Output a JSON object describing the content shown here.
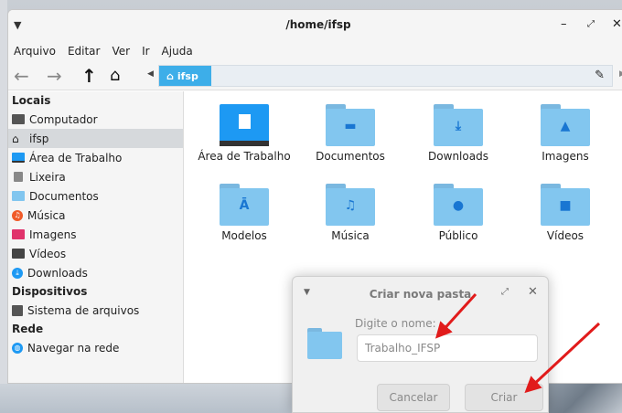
{
  "window": {
    "title": "/home/ifsp",
    "menu": [
      "Arquivo",
      "Editar",
      "Ver",
      "Ir",
      "Ajuda"
    ],
    "breadcrumb": "ifsp"
  },
  "sidebar": {
    "sections": [
      {
        "title": "Locais",
        "items": [
          {
            "label": "Computador",
            "icon": "computer-icon",
            "color": "#555555"
          },
          {
            "label": "ifsp",
            "icon": "home-icon",
            "color": "#222222",
            "active": true
          },
          {
            "label": "Área de Trabalho",
            "icon": "desktop-icon",
            "color": "#1d99f3"
          },
          {
            "label": "Lixeira",
            "icon": "trash-icon",
            "color": "#888888"
          },
          {
            "label": "Documentos",
            "icon": "documents-folder-icon",
            "color": "#82c6ef"
          },
          {
            "label": "Música",
            "icon": "music-icon",
            "color": "#f05a28"
          },
          {
            "label": "Imagens",
            "icon": "images-icon",
            "color": "#e0336b"
          },
          {
            "label": "Vídeos",
            "icon": "videos-icon",
            "color": "#444444"
          },
          {
            "label": "Downloads",
            "icon": "downloads-icon",
            "color": "#1d99f3"
          }
        ]
      },
      {
        "title": "Dispositivos",
        "items": [
          {
            "label": "Sistema de arquivos",
            "icon": "drive-icon",
            "color": "#555555"
          }
        ]
      },
      {
        "title": "Rede",
        "items": [
          {
            "label": "Navegar na rede",
            "icon": "network-icon",
            "color": "#1d99f3"
          }
        ]
      }
    ]
  },
  "files": [
    {
      "label": "Área de Trabalho",
      "icon": "desktop-folder-icon",
      "emblem": ""
    },
    {
      "label": "Documentos",
      "icon": "documents-folder-icon",
      "emblem": "▬"
    },
    {
      "label": "Downloads",
      "icon": "downloads-folder-icon",
      "emblem": "⤓"
    },
    {
      "label": "Imagens",
      "icon": "images-folder-icon",
      "emblem": "▲"
    },
    {
      "label": "Modelos",
      "icon": "templates-folder-icon",
      "emblem": "Ā"
    },
    {
      "label": "Música",
      "icon": "music-folder-icon",
      "emblem": "♫"
    },
    {
      "label": "Público",
      "icon": "public-folder-icon",
      "emblem": "●"
    },
    {
      "label": "Vídeos",
      "icon": "videos-folder-icon",
      "emblem": "■"
    }
  ],
  "dialog": {
    "title": "Criar nova pasta",
    "prompt": "Digite o nome:",
    "input_value": "Trabalho_IFSP",
    "cancel_label": "Cancelar",
    "create_label": "Criar"
  },
  "colors": {
    "accent": "#3daee9",
    "folder": "#82c6ef",
    "annotation_arrow": "#e11b1b"
  }
}
